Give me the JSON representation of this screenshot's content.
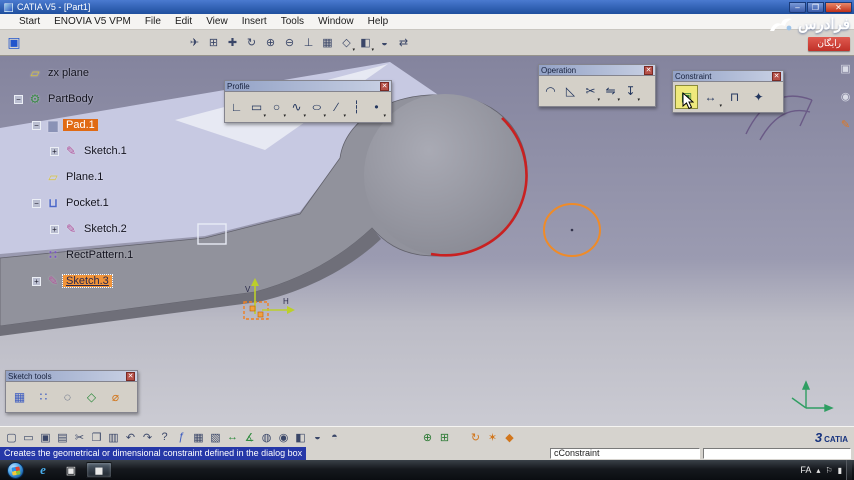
{
  "window": {
    "title": "CATIA V5 - [Part1]",
    "minimize": "–",
    "maximize": "❐",
    "close": "✕"
  },
  "menu": {
    "items": [
      {
        "name": "menu-start",
        "label": "Start"
      },
      {
        "name": "menu-enovia-v5-vpm",
        "label": "ENOVIA V5 VPM"
      },
      {
        "name": "menu-file",
        "label": "File"
      },
      {
        "name": "menu-edit",
        "label": "Edit"
      },
      {
        "name": "menu-view",
        "label": "View"
      },
      {
        "name": "menu-insert",
        "label": "Insert"
      },
      {
        "name": "menu-tools",
        "label": "Tools"
      },
      {
        "name": "menu-window",
        "label": "Window"
      },
      {
        "name": "menu-help",
        "label": "Help"
      }
    ]
  },
  "view_toolbar": {
    "app_icon": "▣",
    "icons": [
      {
        "name": "fly-mode-icon",
        "glyph": "✈",
        "dd": ""
      },
      {
        "name": "fit-all-in-icon",
        "glyph": "⊞",
        "dd": ""
      },
      {
        "name": "pan-icon",
        "glyph": "✚",
        "dd": ""
      },
      {
        "name": "rotate-icon",
        "glyph": "↻",
        "dd": ""
      },
      {
        "name": "zoom-in-icon",
        "glyph": "⊕",
        "dd": ""
      },
      {
        "name": "zoom-out-icon",
        "glyph": "⊖",
        "dd": ""
      },
      {
        "name": "normal-view-icon",
        "glyph": "⊥",
        "dd": ""
      },
      {
        "name": "multi-view-icon",
        "glyph": "▦",
        "dd": ""
      },
      {
        "name": "quick-view-icon",
        "glyph": "◇",
        "dd": "▾"
      },
      {
        "name": "shading-icon",
        "glyph": "◧",
        "dd": "▾"
      },
      {
        "name": "hide-show-icon",
        "glyph": "◒",
        "dd": ""
      },
      {
        "name": "swap-visible-space-icon",
        "glyph": "⇄",
        "dd": ""
      }
    ]
  },
  "tree": {
    "items": [
      {
        "name": "tree-item-zx-plane",
        "label": "zx plane",
        "glyph": "▱",
        "ic": "ic-plane",
        "ind": "",
        "e": "",
        "sel": ""
      },
      {
        "name": "tree-item-partbody",
        "label": "PartBody",
        "glyph": "⚙",
        "ic": "ic-body",
        "ind": "",
        "e": "−",
        "sel": ""
      },
      {
        "name": "tree-item-pad1",
        "label": "Pad.1",
        "glyph": "▆",
        "ic": "ic-pad",
        "ind": "ind1",
        "e": "−",
        "sel": "sel-a"
      },
      {
        "name": "tree-item-sketch1",
        "label": "Sketch.1",
        "glyph": "✎",
        "ic": "ic-sketch",
        "ind": "ind2",
        "e": "+",
        "sel": ""
      },
      {
        "name": "tree-item-plane1",
        "label": "Plane.1",
        "glyph": "▱",
        "ic": "ic-plane",
        "ind": "ind1",
        "e": "",
        "sel": ""
      },
      {
        "name": "tree-item-pocket1",
        "label": "Pocket.1",
        "glyph": "⊔",
        "ic": "ic-pocket",
        "ind": "ind1",
        "e": "−",
        "sel": ""
      },
      {
        "name": "tree-item-sketch2",
        "label": "Sketch.2",
        "glyph": "✎",
        "ic": "ic-sketch",
        "ind": "ind2",
        "e": "+",
        "sel": ""
      },
      {
        "name": "tree-item-rectpattern1",
        "label": "RectPattern.1",
        "glyph": "∷",
        "ic": "ic-pattern",
        "ind": "ind1",
        "e": "",
        "sel": ""
      },
      {
        "name": "tree-item-sketch3",
        "label": "Sketch.3",
        "glyph": "✎",
        "ic": "ic-sketch",
        "ind": "ind1",
        "e": "+",
        "sel": "sel-b"
      }
    ]
  },
  "right_dock": {
    "icons": [
      {
        "name": "dock-tool-icon-1",
        "glyph": "▣",
        "cls": ""
      },
      {
        "name": "dock-tool-icon-2",
        "glyph": "◉",
        "cls": ""
      },
      {
        "name": "sketcher-workbench-icon",
        "glyph": "✎",
        "cls": "org"
      }
    ]
  },
  "palettes": {
    "close_glyph": "✕",
    "profile": {
      "title": "Profile",
      "icons": [
        {
          "name": "profile-tool-icon",
          "glyph": "∟",
          "dd": "",
          "cls": ""
        },
        {
          "name": "rectangle-tool-icon",
          "glyph": "▭",
          "dd": "▾",
          "cls": ""
        },
        {
          "name": "circle-tool-icon",
          "glyph": "○",
          "dd": "▾",
          "cls": ""
        },
        {
          "name": "spline-tool-icon",
          "glyph": "∿",
          "dd": "▾",
          "cls": ""
        },
        {
          "name": "conic-tool-icon",
          "glyph": "○",
          "dd": "▾",
          "cls": "squish"
        },
        {
          "name": "line-tool-icon",
          "glyph": "∕",
          "dd": "▾",
          "cls": ""
        },
        {
          "name": "axis-tool-icon",
          "glyph": "┆",
          "dd": "",
          "cls": ""
        },
        {
          "name": "point-tool-icon",
          "glyph": "•",
          "dd": "▾",
          "cls": ""
        }
      ]
    },
    "operation": {
      "title": "Operation",
      "icons": [
        {
          "name": "corner-tool-icon",
          "glyph": "◠",
          "dd": "",
          "cls": ""
        },
        {
          "name": "chamfer-tool-icon",
          "glyph": "◺",
          "dd": "",
          "cls": ""
        },
        {
          "name": "trim-tool-icon",
          "glyph": "✂",
          "dd": "▾",
          "cls": ""
        },
        {
          "name": "mirror-tool-icon",
          "glyph": "⇋",
          "dd": "▾",
          "cls": ""
        },
        {
          "name": "project-3d-elements-icon",
          "glyph": "↧",
          "dd": "▾",
          "cls": ""
        }
      ]
    },
    "constraint": {
      "title": "Constraint",
      "icons": [
        {
          "name": "constraints-dialog-icon",
          "glyph": "▣",
          "dd": "",
          "cls": "pressed grn"
        },
        {
          "name": "constraint-icon",
          "glyph": "↔",
          "dd": "▾",
          "cls": ""
        },
        {
          "name": "fix-together-icon",
          "glyph": "⊓",
          "dd": "",
          "cls": ""
        },
        {
          "name": "auto-constraint-icon",
          "glyph": "✦",
          "dd": "",
          "cls": ""
        }
      ]
    },
    "sketch_tools": {
      "title": "Sketch tools",
      "icons": [
        {
          "name": "grid-icon",
          "glyph": "▦",
          "dd": "",
          "cls": "blu"
        },
        {
          "name": "snap-to-point-icon",
          "glyph": "∷",
          "dd": "",
          "cls": "blu"
        },
        {
          "name": "construction-element-icon",
          "glyph": "◌",
          "dd": "",
          "cls": ""
        },
        {
          "name": "geometrical-constraints-icon",
          "glyph": "◇",
          "dd": "",
          "cls": "grn2"
        },
        {
          "name": "dimensional-constraints-icon",
          "glyph": "⌀",
          "dd": "",
          "cls": "org"
        }
      ]
    }
  },
  "viewport": {
    "h_label": "H",
    "v_label": "V",
    "colors": {
      "background_top": "#84849e",
      "background_bottom": "#cbcbd3",
      "face": "#c7c9e2",
      "part": "#91929c",
      "highlight_edge": "#c92121",
      "sketch_orange": "#ef8b28",
      "axis_green": "#bccf2a"
    }
  },
  "standard_toolbar": {
    "logo_mark": "3",
    "logo_text": "CATIA",
    "icons": [
      {
        "name": "new-document-icon",
        "glyph": "▢",
        "cls": ""
      },
      {
        "name": "open-icon",
        "glyph": "▭",
        "cls": ""
      },
      {
        "name": "save-icon",
        "glyph": "▣",
        "cls": ""
      },
      {
        "name": "print-icon",
        "glyph": "▤",
        "cls": ""
      },
      {
        "name": "cut-icon",
        "glyph": "✂",
        "cls": ""
      },
      {
        "name": "copy-icon",
        "glyph": "❐",
        "cls": ""
      },
      {
        "name": "paste-icon",
        "glyph": "▥",
        "cls": ""
      },
      {
        "name": "undo-icon",
        "glyph": "↶",
        "cls": ""
      },
      {
        "name": "redo-icon",
        "glyph": "↷",
        "cls": ""
      },
      {
        "name": "whats-this-icon",
        "glyph": "?",
        "cls": ""
      },
      {
        "name": "formula-icon",
        "glyph": "ƒ",
        "cls": "blu"
      },
      {
        "name": "design-table-icon",
        "glyph": "▦",
        "cls": ""
      },
      {
        "name": "catalog-browser-icon",
        "glyph": "▧",
        "cls": ""
      },
      {
        "name": "measure-between-icon",
        "glyph": "↔",
        "cls": "grn2"
      },
      {
        "name": "measure-item-icon",
        "glyph": "∡",
        "cls": "grn2"
      },
      {
        "name": "apply-material-icon",
        "glyph": "◍",
        "cls": ""
      },
      {
        "name": "image-capture-icon",
        "glyph": "◉",
        "cls": ""
      },
      {
        "name": "shading-mode-icon",
        "glyph": "◧",
        "cls": ""
      },
      {
        "name": "hide-show-toggle-icon",
        "glyph": "◒",
        "cls": ""
      },
      {
        "name": "depth-effect-icon",
        "glyph": "◓",
        "cls": ""
      },
      {
        "name": "green-tool-icon-1",
        "glyph": "⊕",
        "cls": "grn gap"
      },
      {
        "name": "green-tool-icon-2",
        "glyph": "⊞",
        "cls": "grn"
      },
      {
        "name": "update-icon",
        "glyph": "↻",
        "cls": "org gap2"
      },
      {
        "name": "sketch-analysis-icon",
        "glyph": "✶",
        "cls": "org"
      },
      {
        "name": "datum-icon",
        "glyph": "◆",
        "cls": "org"
      }
    ]
  },
  "status": {
    "message": "Creates the geometrical or dimensional constraint defined in the dialog box",
    "command": "cConstraint",
    "field2": ""
  },
  "taskbar": {
    "language": "FA",
    "apps": [
      {
        "name": "taskbar-ie-button",
        "glyph": "e",
        "cls": "ie"
      },
      {
        "name": "taskbar-app-button-1",
        "glyph": "▣",
        "cls": "dark"
      },
      {
        "name": "taskbar-app-button-2",
        "glyph": "◼",
        "cls": "dark active"
      }
    ],
    "tray": [
      {
        "name": "hidden-icons-chevron",
        "glyph": "▴"
      },
      {
        "name": "action-center-icon",
        "glyph": "⚐"
      },
      {
        "name": "network-icon",
        "glyph": "▮"
      }
    ]
  },
  "watermark": {
    "brand": "فرادرس",
    "badge": "رایگان"
  }
}
